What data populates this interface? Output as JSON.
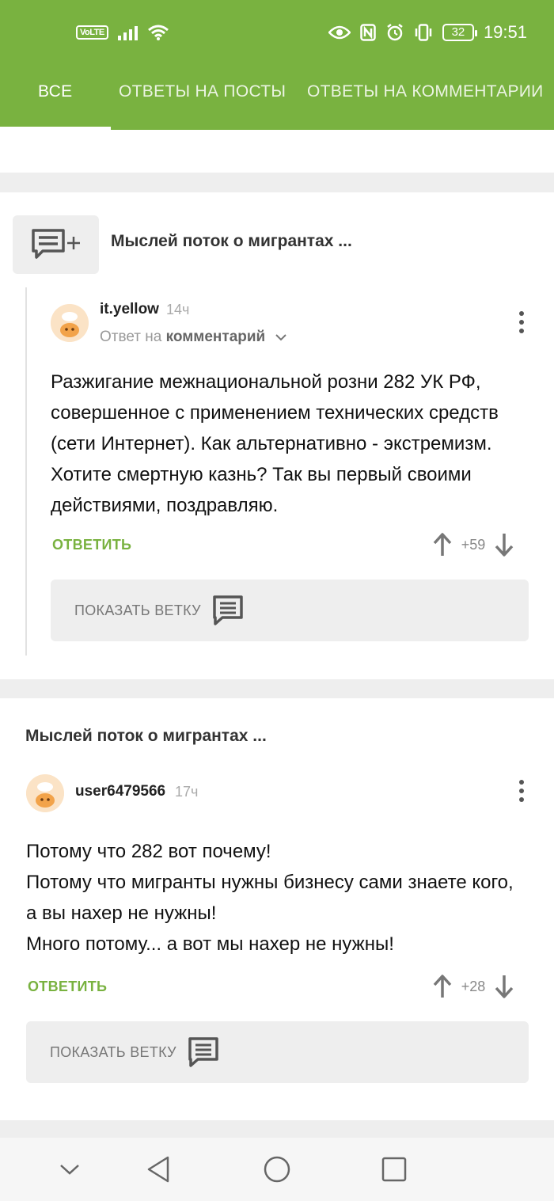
{
  "status_bar": {
    "volte": "VoLTE",
    "battery": "32",
    "time": "19:51",
    "icons": [
      "signal-icon",
      "wifi-icon",
      "eye-icon",
      "nfc-icon",
      "alarm-icon",
      "vibrate-icon",
      "battery-icon"
    ]
  },
  "tabs": [
    {
      "label": "ВСЕ",
      "active": true
    },
    {
      "label": "ОТВЕТЫ НА ПОСТЫ",
      "active": false
    },
    {
      "label": "ОТВЕТЫ НА КОММЕНТАРИИ",
      "active": false
    }
  ],
  "colors": {
    "accent": "#79b240",
    "background": "#eeeeee"
  },
  "comments": [
    {
      "post_title": "Мыслей поток о мигрантах ...",
      "username": "it.yellow",
      "time": "14ч",
      "reply_prefix": "Ответ на",
      "reply_target": "комментарий",
      "text": "Разжигание межнациональной розни 282 УК РФ, совершенное с применением технических средств (сети Интернет). Как альтернативно - экстремизм. Хотите смертную казнь? Так вы первый своими действиями, поздравляю.",
      "reply_label": "ОТВЕТИТЬ",
      "score": "+59",
      "branch_label": "ПОКАЗАТЬ ВЕТКУ"
    },
    {
      "post_title": "Мыслей поток о мигрантах ...",
      "username": "user6479566",
      "time": "17ч",
      "text_lines": [
        "Потому что 282 вот почему!",
        "Потому что мигранты нужны бизнесу сами знаете кого, а вы нахер не нужны!",
        "Много потому... а вот мы нахер не нужны!"
      ],
      "reply_label": "ОТВЕТИТЬ",
      "score": "+28",
      "branch_label": "ПОКАЗАТЬ ВЕТКУ"
    }
  ],
  "nav": [
    "chevron-down-icon",
    "back-icon",
    "home-icon",
    "recents-icon"
  ]
}
